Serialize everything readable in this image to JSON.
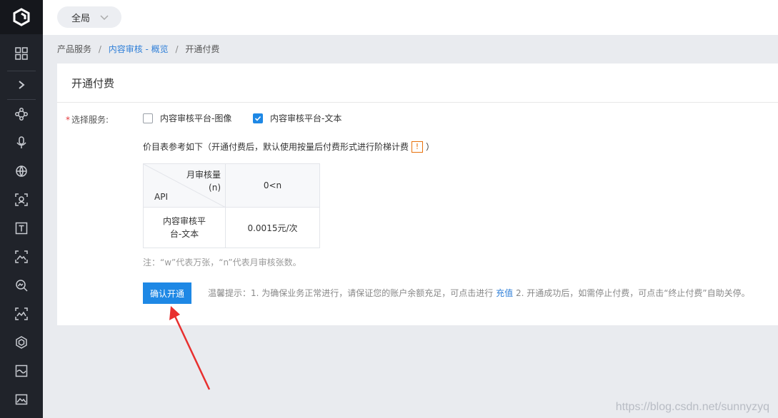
{
  "topbar": {
    "scope": "全局"
  },
  "breadcrumb": {
    "root": "产品服务",
    "separator": "/",
    "parent": "内容审核 - 概览",
    "current": "开通付费"
  },
  "card": {
    "title": "开通付费",
    "service_label": "选择服务:",
    "required_mark": "*",
    "options": [
      {
        "label": "内容审核平台-图像",
        "checked": false
      },
      {
        "label": "内容审核平台-文本",
        "checked": true
      }
    ],
    "price_note": "价目表参考如下（开通付费后，默认使用按量后付费形式进行阶梯计费",
    "price_note_close": "）",
    "info_badge": "!",
    "table": {
      "header_top_line1": "月审核量",
      "header_top_line2": "(n)",
      "header_bottom": "API",
      "column": "0<n",
      "rows": [
        {
          "api_line1": "内容审核平",
          "api_line2": "台-文本",
          "price": "0.0015元/次"
        }
      ]
    },
    "footnote": "注：“w”代表万张，“n”代表月审核张数。",
    "confirm_button": "确认开通",
    "tip_prefix": "温馨提示：1. 为确保业务正常进行，请保证您的账户余额充足，可点击进行",
    "tip_link": "充值",
    "tip_suffix": "2. 开通成功后，如需停止付费，可点击“终止付费”自助关停。"
  },
  "sidebar": {
    "icons": [
      "logo-icon",
      "grid-icon",
      "expand-icon",
      "nodes-icon",
      "microphone-icon",
      "globe-icon",
      "face-scan-icon",
      "text-icon",
      "image-scan-icon",
      "search-image-icon",
      "landscape-scan-icon",
      "cube-icon",
      "image-wave-icon",
      "image-icon"
    ]
  },
  "watermark": "https://blog.csdn.net/sunnyzyq",
  "colors": {
    "accent": "#1e88e5",
    "sidebar": "#20232a",
    "annotation_arrow": "#e8302f"
  }
}
